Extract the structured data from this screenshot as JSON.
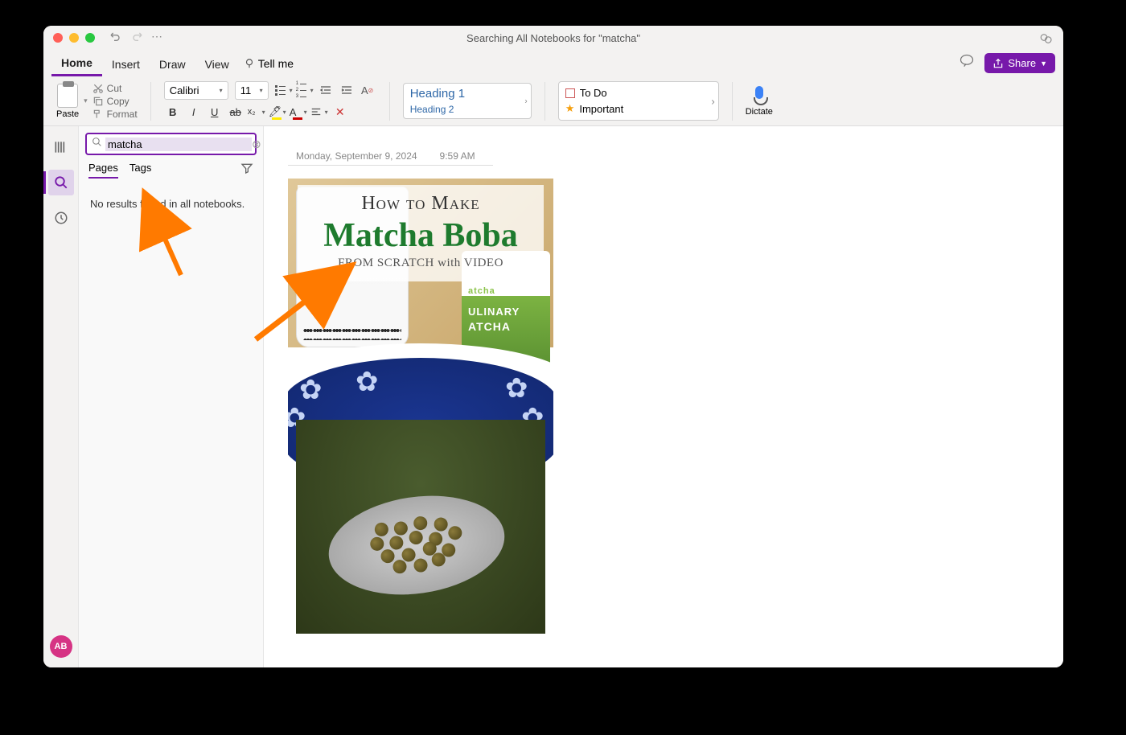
{
  "window": {
    "title": "Searching All Notebooks for \"matcha\""
  },
  "tabs": {
    "home": "Home",
    "insert": "Insert",
    "draw": "Draw",
    "view": "View",
    "tellme": "Tell me"
  },
  "share": "Share",
  "clipboard": {
    "paste": "Paste",
    "cut": "Cut",
    "copy": "Copy",
    "format": "Format"
  },
  "font": {
    "name": "Calibri",
    "size": "11"
  },
  "styles": {
    "h1": "Heading 1",
    "h2": "Heading 2"
  },
  "tags": {
    "todo": "To Do",
    "important": "Important"
  },
  "dictate": "Dictate",
  "search": {
    "value": "matcha",
    "tab_pages": "Pages",
    "tab_tags": "Tags",
    "no_results": "No results found in all notebooks."
  },
  "avatar": "AB",
  "note": {
    "date": "Monday, September 9, 2024",
    "time": "9:59 AM",
    "banner_l1": "How to Make",
    "banner_l2": "Matcha Boba",
    "banner_l3": "FROM SCRATCH with VIDEO",
    "can_l1": "atcha",
    "can_l2": "ULINARY",
    "can_l3": "ATCHA"
  }
}
